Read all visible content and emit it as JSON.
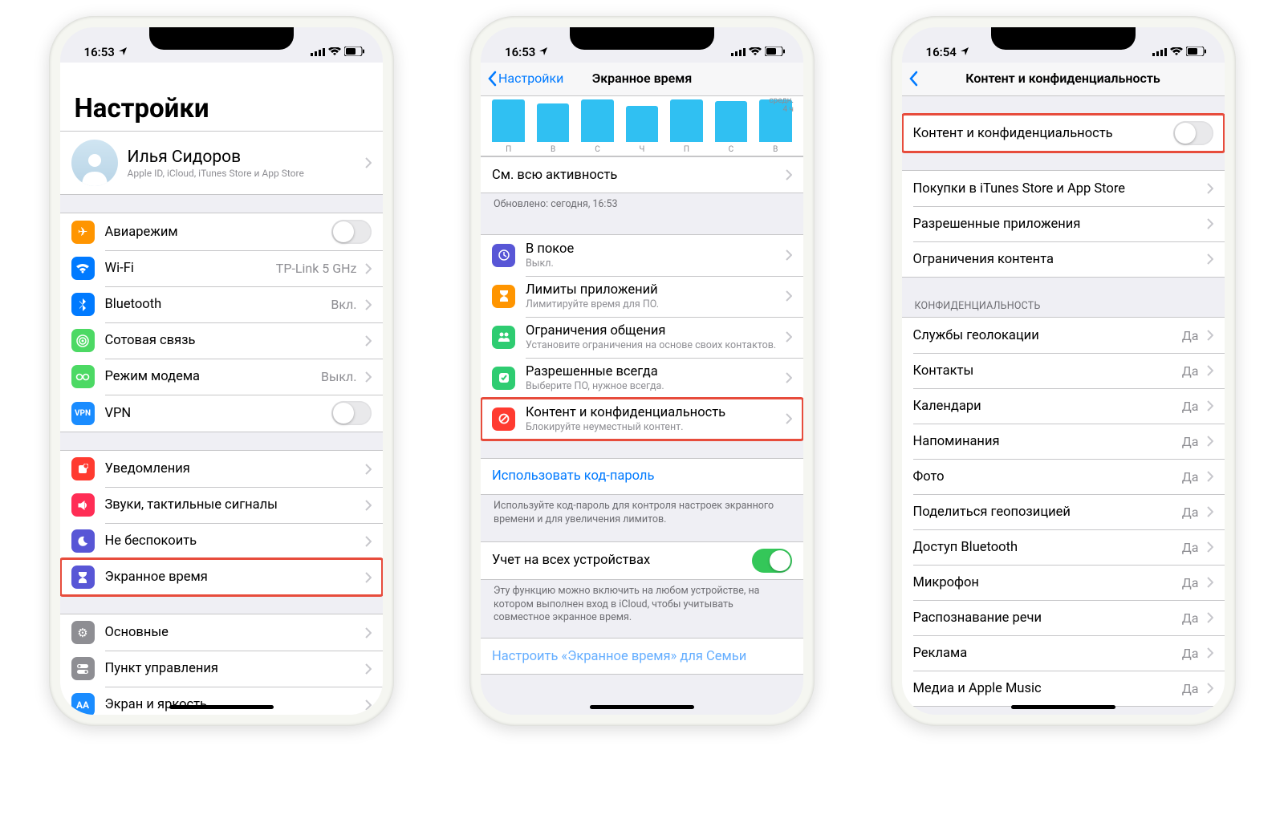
{
  "phone1": {
    "status": {
      "time": "16:53",
      "loc": "➤"
    },
    "title": "Настройки",
    "profile": {
      "name": "Илья Сидоров",
      "sub": "Apple ID, iCloud, iTunes Store и App Store"
    },
    "g1": [
      {
        "label": "Авиарежим",
        "type": "toggle",
        "on": false,
        "icon": "airplane"
      },
      {
        "label": "Wi-Fi",
        "detail": "TP-Link 5 GHz",
        "type": "nav",
        "icon": "wifi"
      },
      {
        "label": "Bluetooth",
        "detail": "Вкл.",
        "type": "nav",
        "icon": "bluetooth"
      },
      {
        "label": "Сотовая связь",
        "type": "nav",
        "icon": "cell"
      },
      {
        "label": "Режим модема",
        "detail": "Выкл.",
        "type": "nav",
        "icon": "hotspot"
      },
      {
        "label": "VPN",
        "type": "toggle",
        "on": false,
        "icon": "vpn"
      }
    ],
    "g2": [
      {
        "label": "Уведомления",
        "type": "nav",
        "icon": "notif"
      },
      {
        "label": "Звуки, тактильные сигналы",
        "type": "nav",
        "icon": "sound"
      },
      {
        "label": "Не беспокоить",
        "type": "nav",
        "icon": "moon"
      },
      {
        "label": "Экранное время",
        "type": "nav",
        "icon": "hourglass",
        "highlight": true
      }
    ],
    "g3": [
      {
        "label": "Основные",
        "type": "nav",
        "icon": "gear"
      },
      {
        "label": "Пункт управления",
        "type": "nav",
        "icon": "toggles"
      },
      {
        "label": "Экран и яркость",
        "type": "nav",
        "icon": "aa"
      }
    ]
  },
  "phone2": {
    "status": {
      "time": "16:53"
    },
    "nav": {
      "back": "Настройки",
      "title": "Экранное время"
    },
    "chart_meta": {
      "side1": "средн.",
      "side2": "4 ч"
    },
    "chart_labels": [
      "П",
      "В",
      "С",
      "Ч",
      "П",
      "С",
      "В"
    ],
    "activity": {
      "label": "См. всю активность"
    },
    "updated": "Обновлено: сегодня, 16:53",
    "rows": [
      {
        "title": "В покое",
        "sub": "Выкл.",
        "icon": "moon-p"
      },
      {
        "title": "Лимиты приложений",
        "sub": "Лимитируйте время для ПО.",
        "icon": "hourglass-o"
      },
      {
        "title": "Ограничения общения",
        "sub": "Установите ограничения на основе своих контактов.",
        "icon": "people"
      },
      {
        "title": "Разрешенные всегда",
        "sub": "Выберите ПО, нужное всегда.",
        "icon": "check"
      },
      {
        "title": "Контент и конфиденциальность",
        "sub": "Блокируйте неуместный контент.",
        "icon": "forbid",
        "highlight": true
      }
    ],
    "passcode": {
      "label": "Использовать код-пароль"
    },
    "passcode_footer": "Используйте код-пароль для контроля настроек экранного времени и для увеличения лимитов.",
    "alldev": {
      "label": "Учет на всех устройствах",
      "on": true
    },
    "alldev_footer": "Эту функцию можно включить на любом устройстве, на котором выполнен вход в iCloud, чтобы учитывать совместное экранное время.",
    "family": "Настроить «Экранное время» для Семьи"
  },
  "phone3": {
    "status": {
      "time": "16:54"
    },
    "nav": {
      "title": "Контент и конфиденциальность"
    },
    "restrict": {
      "label": "Контент и конфиденциальность",
      "on": false,
      "highlight": true
    },
    "g1": [
      {
        "label": "Покупки в iTunes Store и App Store"
      },
      {
        "label": "Разрешенные приложения"
      },
      {
        "label": "Ограничения контента"
      }
    ],
    "priv_header": "КОНФИДЕНЦИАЛЬНОСТЬ",
    "g2": [
      {
        "label": "Службы геолокации",
        "detail": "Да"
      },
      {
        "label": "Контакты",
        "detail": "Да"
      },
      {
        "label": "Календари",
        "detail": "Да"
      },
      {
        "label": "Напоминания",
        "detail": "Да"
      },
      {
        "label": "Фото",
        "detail": "Да"
      },
      {
        "label": "Поделиться геопозицией",
        "detail": "Да"
      },
      {
        "label": "Доступ Bluetooth",
        "detail": "Да"
      },
      {
        "label": "Микрофон",
        "detail": "Да"
      },
      {
        "label": "Распознавание речи",
        "detail": "Да"
      },
      {
        "label": "Реклама",
        "detail": "Да"
      },
      {
        "label": "Медиа и Apple Music",
        "detail": "Да"
      }
    ]
  },
  "chart_data": {
    "type": "bar",
    "categories": [
      "П",
      "В",
      "С",
      "Ч",
      "П",
      "С",
      "В"
    ],
    "values": [
      4.0,
      3.6,
      4.0,
      3.4,
      4.0,
      3.8,
      4.0
    ],
    "ylabel_top": "средн.",
    "ylabel_val": "4 ч",
    "ylim": [
      0,
      4.5
    ]
  }
}
